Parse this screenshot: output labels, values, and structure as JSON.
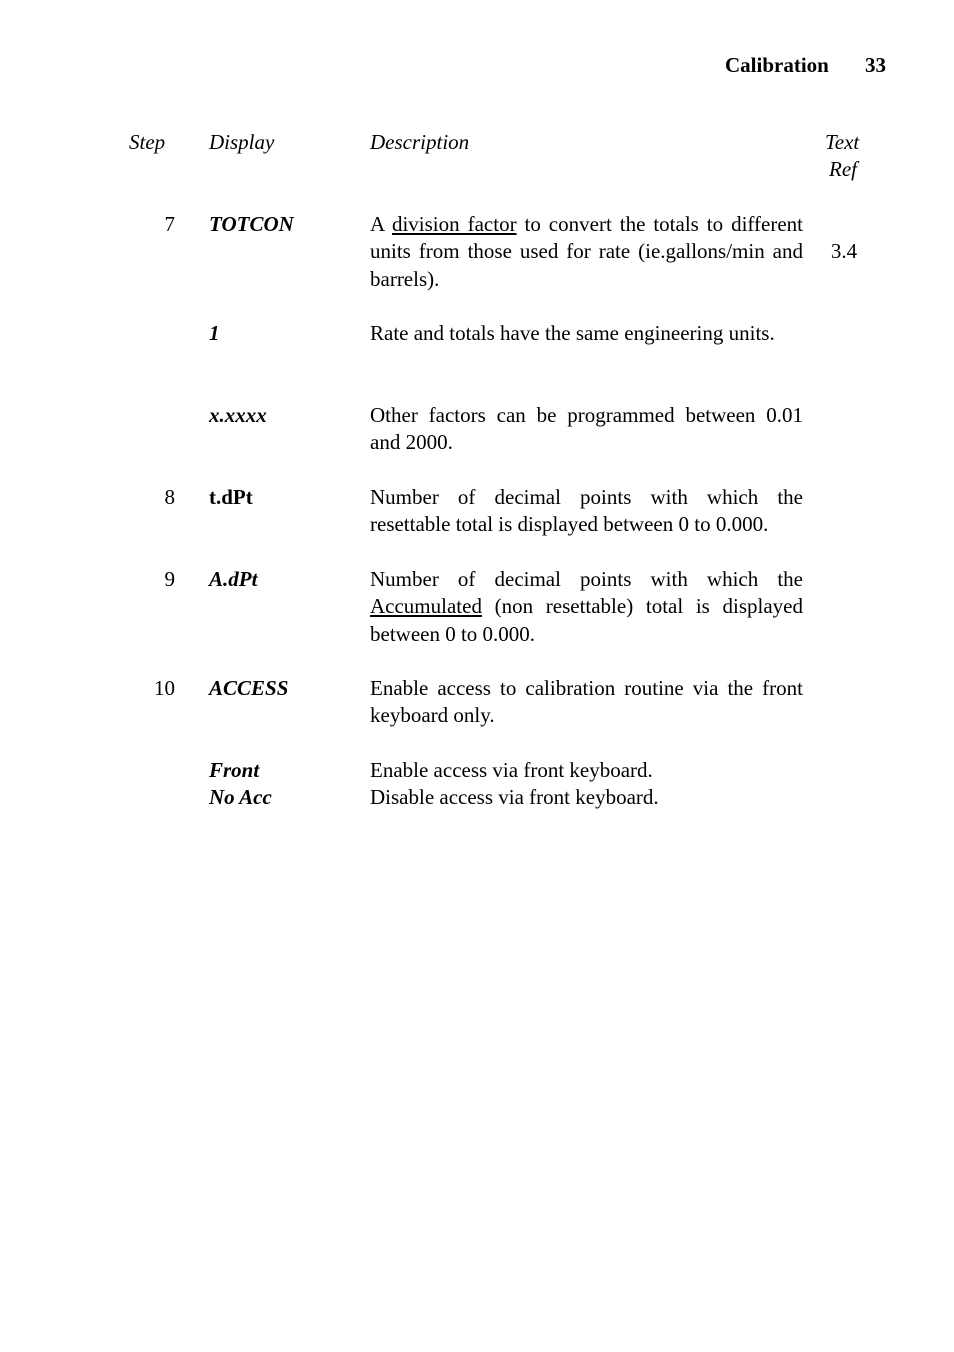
{
  "header": {
    "section": "Calibration",
    "page_number": "33"
  },
  "columns": {
    "step": "Step",
    "display": "Display",
    "description": "Description",
    "text_ref_line1": "Text",
    "text_ref_line2": "Ref"
  },
  "rows": [
    {
      "step": "7",
      "display": "TOTCON",
      "desc_pre": "A ",
      "desc_underlined": "division factor",
      "desc_post": " to convert the totals to different units from those used for rate (ie.gallons/min and barrels).",
      "ref": "3.4"
    },
    {
      "step": "",
      "display": "1",
      "description": "Rate and totals have the same engineering units."
    },
    {
      "step": "",
      "display": "x.xxxx",
      "description": "Other factors can be programmed between 0.01 and 2000."
    },
    {
      "step": "8",
      "display": "t.dPt",
      "description": "Number of decimal points with which the resettable total is displayed between 0 to 0.000."
    },
    {
      "step": "9",
      "display": "A.dPt",
      "desc_pre": "Number of decimal points with which the ",
      "desc_underlined": "Accumulated",
      "desc_post": " (non resettable) total is displayed between 0 to 0.000."
    },
    {
      "step": "10",
      "display": "ACCESS",
      "description": "Enable access to calibration routine via the front keyboard only."
    },
    {
      "step": "",
      "display": "Front",
      "description": "Enable access via front keyboard."
    },
    {
      "step": "",
      "display": "No Acc",
      "description": "Disable access via front keyboard."
    }
  ]
}
